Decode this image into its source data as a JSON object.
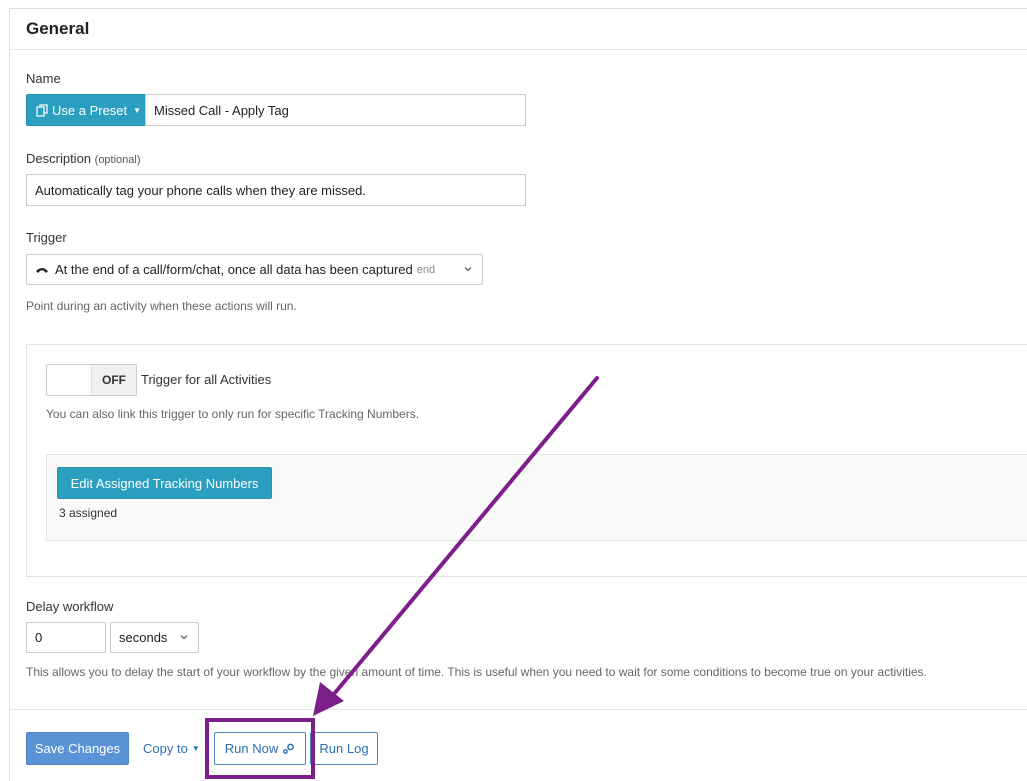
{
  "panel": {
    "title": "General"
  },
  "name_field": {
    "label": "Name",
    "preset_button": "Use a Preset",
    "value": "Missed Call - Apply Tag"
  },
  "description_field": {
    "label": "Description",
    "optional": "(optional)",
    "value": "Automatically tag your phone calls when they are missed."
  },
  "trigger_field": {
    "label": "Trigger",
    "selected": "At the end of a call/form/chat, once all data has been captured",
    "selected_code": "end",
    "help": "Point during an activity when these actions will run."
  },
  "trigger_all": {
    "toggle_state": "OFF",
    "label": "Trigger for all Activities",
    "help": "You can also link this trigger to only run for specific Tracking Numbers."
  },
  "tracking": {
    "edit_button": "Edit Assigned Tracking Numbers",
    "assigned_text": "3 assigned"
  },
  "delay": {
    "label": "Delay workflow",
    "value": "0",
    "unit": "seconds",
    "help": "This allows you to delay the start of your workflow by the given amount of time. This is useful when you need to wait for some conditions to become true on your activities."
  },
  "actions": {
    "save": "Save Changes",
    "copy_to": "Copy to",
    "run_now": "Run Now",
    "run_log": "Run Log"
  },
  "colors": {
    "accent_teal": "#2b9fbf",
    "primary_blue": "#5a93d6",
    "annotation_purple": "#7d1f8a"
  },
  "icons": {
    "preset": "copy-icon",
    "trigger": "phone-hangup-icon",
    "run_now": "gears-icon",
    "caret": "caret-down-icon",
    "chevron": "chevron-down-icon"
  }
}
